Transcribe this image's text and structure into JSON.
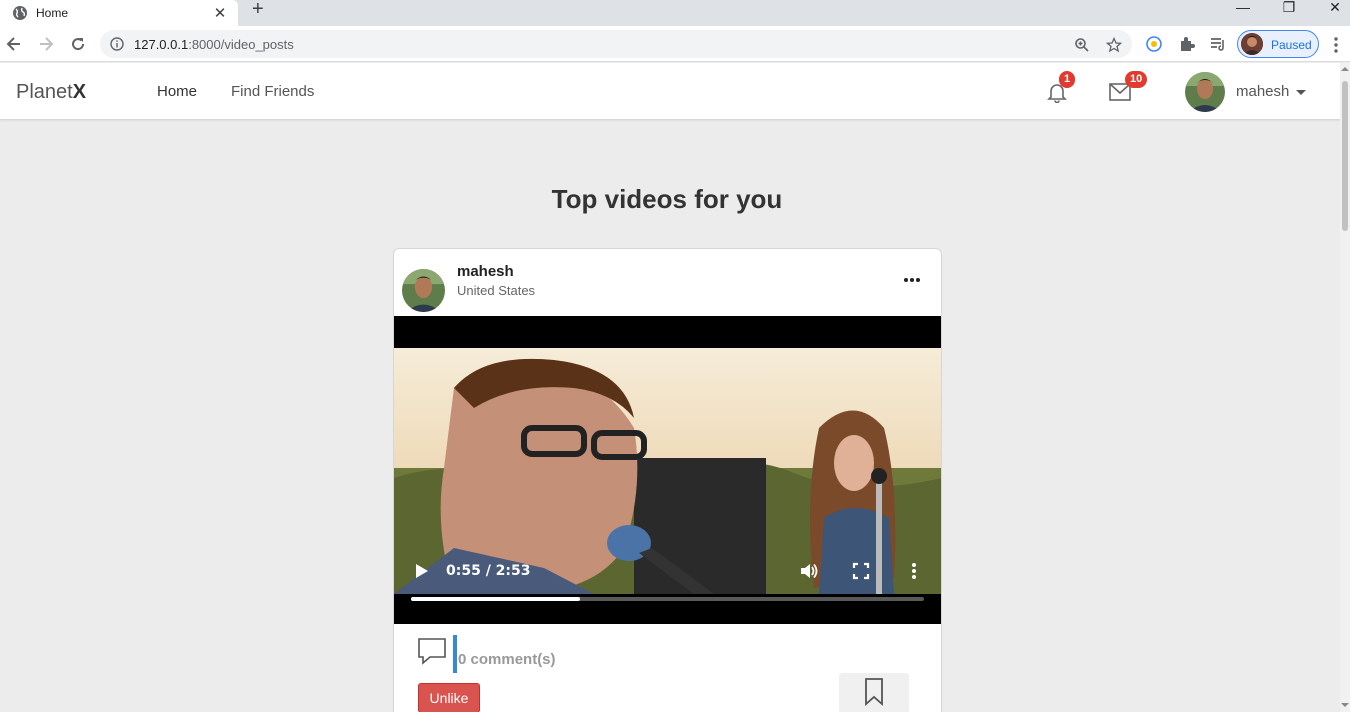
{
  "browser": {
    "tab_title": "Home",
    "tab_close": "✕",
    "new_tab": "+",
    "url_host": "127.0.0.1",
    "url_path": ":8000/video_posts",
    "profile_status": "Paused",
    "window_controls": [
      "—",
      "❐",
      "✕"
    ]
  },
  "site": {
    "brand_prefix": "Planet",
    "brand_suffix": "X",
    "nav": [
      "Home",
      "Find Friends"
    ],
    "notifications_count": "1",
    "messages_count": "10",
    "username": "mahesh"
  },
  "main": {
    "heading": "Top videos for you"
  },
  "post": {
    "author": "mahesh",
    "location": "United States",
    "video": {
      "time_display": "0:55 / 2:53",
      "progress_fraction": 0.33
    },
    "comment_count_label": "0 comment(s)",
    "unlike_label": "Unlike"
  },
  "colors": {
    "unlike": "#d9534f",
    "badge": "#e03b2e",
    "comment_accent": "#3a87d8",
    "page_bg": "#ececec"
  }
}
